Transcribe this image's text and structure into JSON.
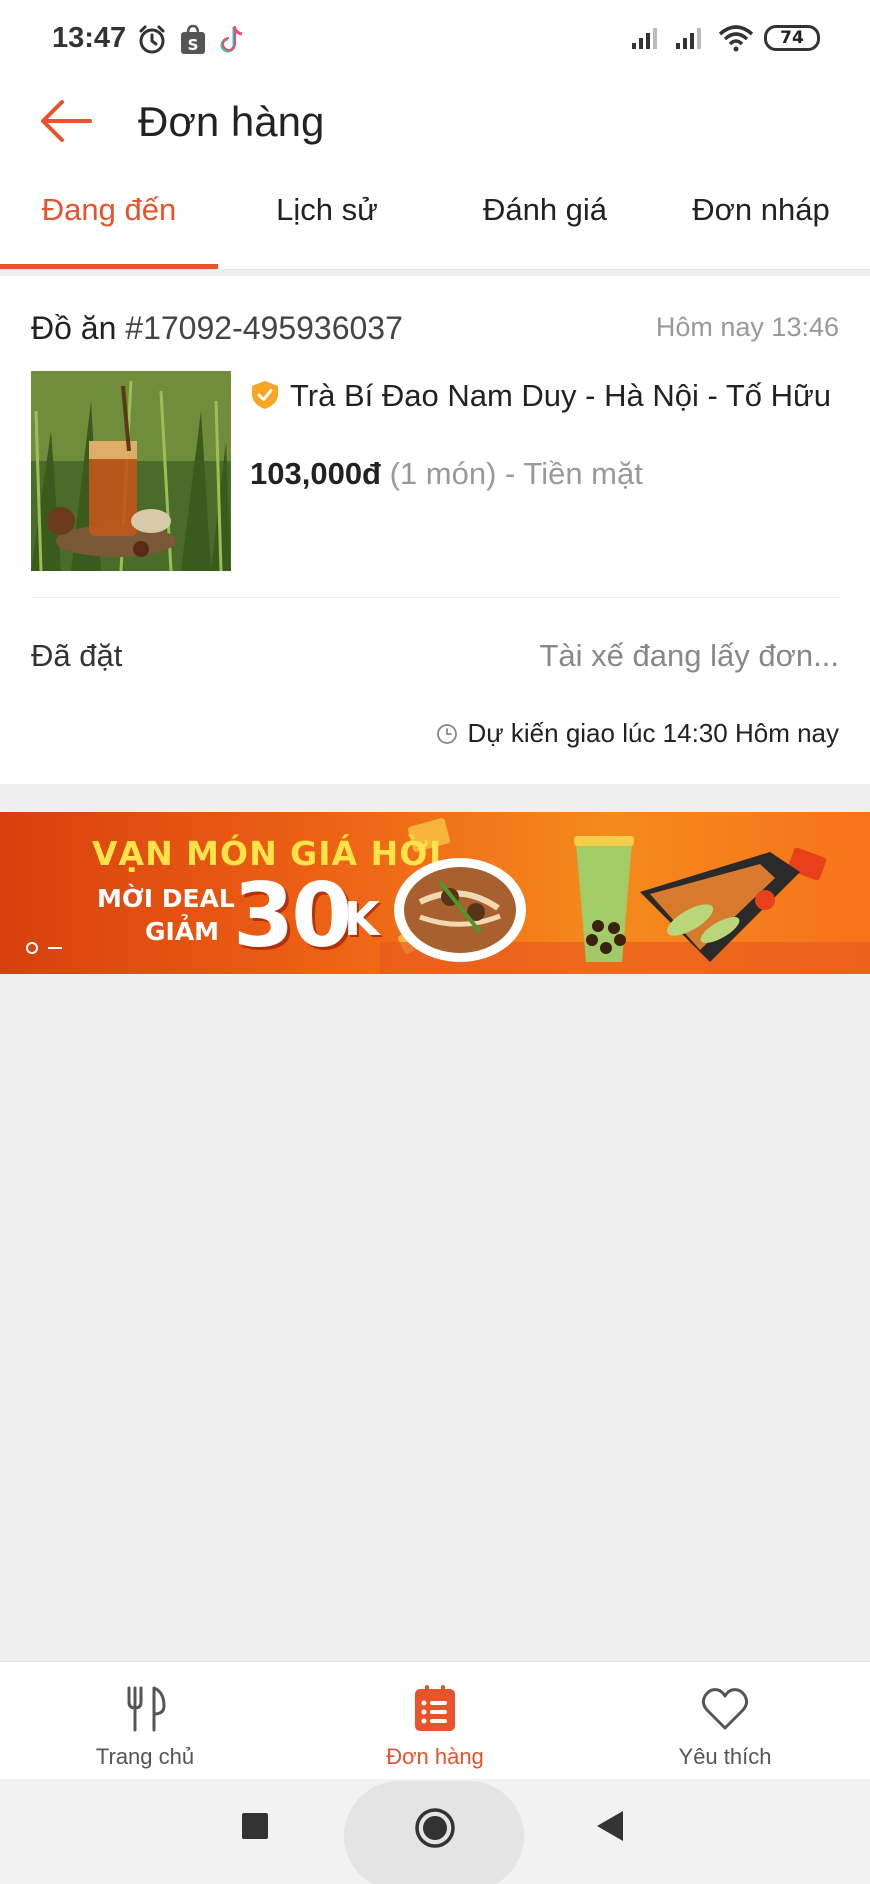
{
  "status_bar": {
    "time": "13:47",
    "battery": "74",
    "icons": [
      "alarm-icon",
      "shopee-icon",
      "tiktok-icon",
      "signal-icon",
      "signal-icon",
      "wifi-icon",
      "battery-icon"
    ]
  },
  "header": {
    "title": "Đơn hàng",
    "back_icon": "arrow-left-icon"
  },
  "tabs": [
    {
      "label": "Đang đến",
      "active": true
    },
    {
      "label": "Lịch sử",
      "active": false
    },
    {
      "label": "Đánh giá",
      "active": false
    },
    {
      "label": "Đơn nháp",
      "active": false
    }
  ],
  "order": {
    "type_label": "Đồ ăn",
    "order_id": "#17092-495936037",
    "time": "Hôm nay 13:46",
    "shop_name": "Trà Bí Đao Nam Duy - Hà Nội - Tố Hữu",
    "price": "103,000đ",
    "details": " (1 món) - Tiền mặt",
    "status": "Đã đặt",
    "driver_status": "Tài xế đang lấy đơn...",
    "eta": "Dự kiến giao lúc 14:30 Hôm nay"
  },
  "banner": {
    "line1": "VẠN MÓN GIÁ HỜI",
    "line2": "MỜI DEAL",
    "line3": "GIẢM",
    "big": "30",
    "unit": "K"
  },
  "bottom_nav": [
    {
      "label": "Trang chủ",
      "icon": "fork-knife-icon",
      "active": false
    },
    {
      "label": "Đơn hàng",
      "icon": "order-list-icon",
      "active": true
    },
    {
      "label": "Yêu thích",
      "icon": "heart-icon",
      "active": false
    }
  ],
  "colors": {
    "accent": "#e8532b",
    "badge": "#f5a623"
  }
}
